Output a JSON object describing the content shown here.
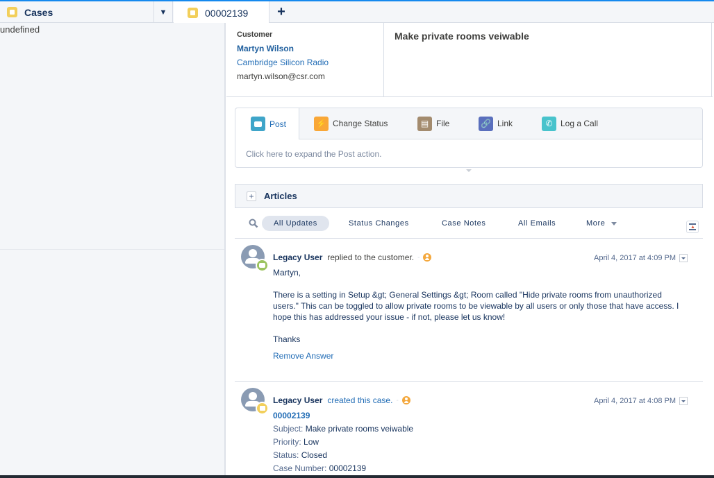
{
  "tabs": {
    "primary": {
      "label": "Cases",
      "icon": "case-icon"
    },
    "active": {
      "label": "00002139",
      "icon": "case-icon"
    },
    "add_label": "+"
  },
  "sidebar": {
    "text": "undefined"
  },
  "header": {
    "customer_label": "Customer",
    "customer_name": "Martyn Wilson",
    "company": "Cambridge Silicon Radio",
    "email": "martyn.wilson@csr.com",
    "subject": "Make private rooms veiwable"
  },
  "publisher": {
    "tabs": [
      {
        "label": "Post",
        "icon": "chat-icon",
        "color": "#3fa5c9"
      },
      {
        "label": "Change Status",
        "icon": "lightning-icon",
        "color": "#f9a737"
      },
      {
        "label": "File",
        "icon": "file-icon",
        "color": "#a38b6e"
      },
      {
        "label": "Link",
        "icon": "link-icon",
        "color": "#5a6fbd"
      },
      {
        "label": "Log a Call",
        "icon": "phone-icon",
        "color": "#48c3cc"
      }
    ],
    "placeholder": "Click here to expand the Post action."
  },
  "articles": {
    "label": "Articles"
  },
  "filters": {
    "items": [
      "All Updates",
      "Status Changes",
      "Case Notes",
      "All Emails",
      "More"
    ]
  },
  "feed": [
    {
      "user": "Legacy User",
      "action": "replied to the customer.",
      "time": "April 4, 2017 at 4:09 PM",
      "greeting": "Martyn,",
      "body": "There is a setting in Setup &gt; General Settings &gt; Room called \"Hide private rooms from unauthorized users.\" This can be toggled to allow private rooms to be viewable by all users or only those that have access. I hope this has addressed your issue - if not, please let us know!",
      "signoff": "Thanks",
      "link": "Remove Answer"
    },
    {
      "user": "Legacy User",
      "action": "created this case.",
      "time": "April 4, 2017 at 4:08 PM",
      "case_number_link": "00002139",
      "fields": [
        {
          "k": "Subject:",
          "v": "Make private rooms veiwable"
        },
        {
          "k": "Priority:",
          "v": "Low"
        },
        {
          "k": "Status:",
          "v": "Closed"
        },
        {
          "k": "Case Number:",
          "v": "00002139"
        }
      ]
    }
  ]
}
